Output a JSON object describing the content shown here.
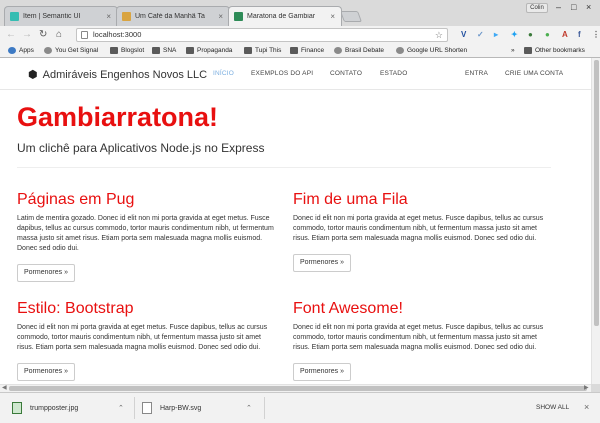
{
  "browser": {
    "tabs": [
      {
        "title": "Item | Semantic UI",
        "favicon_color": "#35bdb2"
      },
      {
        "title": "Um Café da Manhã Ta",
        "favicon_color": "#d9a441"
      },
      {
        "title": "Maratona de Gambiar",
        "favicon_color": "#2e8b57",
        "active": true
      }
    ],
    "profile_label": "Colin",
    "window_controls": {
      "minimize": "–",
      "maximize": "□",
      "close": "×"
    },
    "toolbar": {
      "back_icon": "back-arrow-icon",
      "forward_icon": "forward-arrow-icon",
      "reload_icon": "reload-icon",
      "home_icon": "home-icon",
      "url": "localhost:3000",
      "star_glyph": "☆",
      "extensions": [
        {
          "glyph": "V",
          "color": "#1f4e9e"
        },
        {
          "glyph": "✓",
          "color": "#6a95c9"
        },
        {
          "glyph": "▸",
          "color": "#3fa9f5"
        },
        {
          "glyph": "✦",
          "color": "#1da1f2"
        },
        {
          "glyph": "●",
          "color": "#3b7a3b"
        },
        {
          "glyph": "●",
          "color": "#4caf50"
        },
        {
          "glyph": "A",
          "color": "#c0392b"
        },
        {
          "glyph": "f",
          "color": "#3b5998"
        },
        {
          "glyph": "⋮",
          "color": "#555555"
        }
      ]
    },
    "bookmarks": [
      {
        "label": "Apps",
        "kind": "apps"
      },
      {
        "label": "You Get Signal",
        "kind": "site"
      },
      {
        "label": "Blogslot",
        "kind": "folder"
      },
      {
        "label": "SNA",
        "kind": "folder"
      },
      {
        "label": "Propaganda",
        "kind": "folder"
      },
      {
        "label": "Tupi This",
        "kind": "folder"
      },
      {
        "label": "Finance",
        "kind": "folder"
      },
      {
        "label": "Brasil Debate",
        "kind": "site"
      },
      {
        "label": "Google URL Shorten",
        "kind": "site"
      }
    ],
    "bookmarks_overflow": "»",
    "other_bookmarks": "Other bookmarks"
  },
  "site": {
    "brand": "Admiráveis Engenhos Novos LLC",
    "nav_left": [
      "INÍCIO",
      "EXEMPLOS DO API",
      "CONTATO",
      "ESTADO"
    ],
    "nav_right": [
      "ENTRA",
      "CRIE UMA CONTA"
    ],
    "hero_title": "Gambiarratona!",
    "hero_subtitle": "Um clichê para Aplicativos Node.js no Express",
    "cards": [
      {
        "title": "Páginas em Pug",
        "body": "Latim de mentira gozado. Donec id elit non mi porta gravida at eget metus. Fusce dapibus, tellus ac cursus commodo, tortor mauris condimentum nibh, ut fermentum massa justo sit amet risus. Etiam porta sem malesuada magna mollis euismod. Donec sed odio dui.",
        "button": "Pormenores »"
      },
      {
        "title": "Fim de uma Fila",
        "body": "Donec id elit non mi porta gravida at eget metus. Fusce dapibus, tellus ac cursus commodo, tortor mauris condimentum nibh, ut fermentum massa justo sit amet risus. Etiam porta sem malesuada magna mollis euismod. Donec sed odio dui.",
        "button": "Pormenores »"
      },
      {
        "title": "Estilo: Bootstrap",
        "body": "Donec id elit non mi porta gravida at eget metus. Fusce dapibus, tellus ac cursus commodo, tortor mauris condimentum nibh, ut fermentum massa justo sit amet risus. Etiam porta sem malesuada magna mollis euismod. Donec sed odio dui.",
        "button": "Pormenores »"
      },
      {
        "title": "Font Awesome!",
        "body": "Donec id elit non mi porta gravida at eget metus. Fusce dapibus, tellus ac cursus commodo, tortor mauris condimentum nibh, ut fermentum massa justo sit amet risus. Etiam porta sem malesuada magna mollis euismod. Donec sed odio dui.",
        "button": "Pormenores »"
      }
    ]
  },
  "downloads": {
    "items": [
      {
        "filename": "trumpposter.jpg"
      },
      {
        "filename": "Harp-BW.svg"
      }
    ],
    "show_all": "SHOW ALL",
    "close_glyph": "×"
  }
}
